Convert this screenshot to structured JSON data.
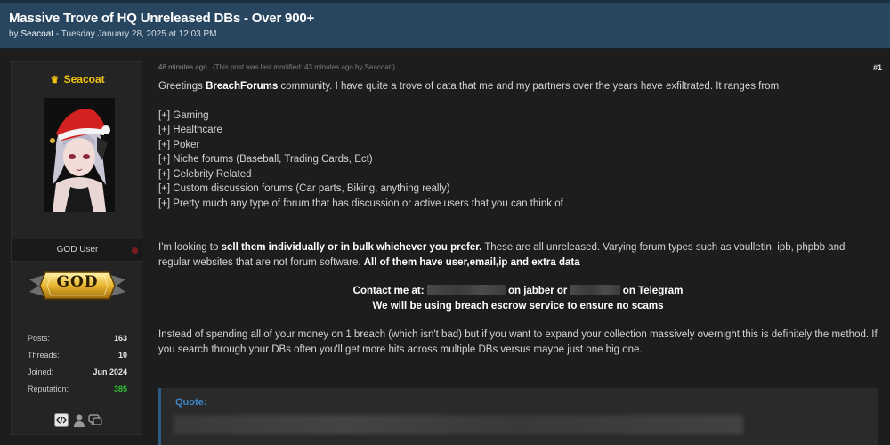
{
  "header": {
    "title": "Massive Trove of HQ Unreleased DBs - Over 900+",
    "by_prefix": "by",
    "author": "Seacoat",
    "date": "Tuesday January 28, 2025 at 12:03 PM"
  },
  "sidebar": {
    "username": "Seacoat",
    "crown": "♛",
    "user_title": "GOD User",
    "rank_badge": "GOD",
    "stats": [
      {
        "label": "Posts:",
        "value": "163"
      },
      {
        "label": "Threads:",
        "value": "10"
      },
      {
        "label": "Joined:",
        "value": "Jun 2024"
      },
      {
        "label": "Reputation:",
        "value": "385"
      }
    ],
    "icons": [
      "code-icon",
      "user-icon",
      "chat-icon"
    ],
    "colors": {
      "username": "#f2c40f",
      "reputation": "#2fbf2f"
    }
  },
  "post": {
    "time": "46 minutes ago",
    "edited_note": "(This post was last modified: 43 minutes ago by Seacoat.)",
    "number": "#1",
    "greeting_a": "Greetings ",
    "greeting_bold": "BreachForums",
    "greeting_b": " community. I have quite a trove of data that me and my partners over the years have exfiltrated. It ranges from",
    "list": [
      "[+] Gaming",
      "[+] Healthcare",
      "[+] Poker",
      "[+] Niche forums (Baseball, Trading Cards, Ect)",
      "[+] Celebrity Related",
      "[+] Custom discussion forums (Car parts, Biking, anything really)",
      "[+] Pretty much any type of forum that has discussion or active users that you can think of"
    ],
    "sell_a": "I'm looking to ",
    "sell_bold": "sell them individually or in bulk whichever you prefer.",
    "sell_b": " These are all unreleased. Varying forum types such as vbulletin, ipb, phpbb and regular websites that are not forum software. ",
    "sell_bold2": "All of them have user,email,ip and extra data",
    "contact_a": "Contact me at: ",
    "contact_b": " on jabber or ",
    "contact_c": " on Telegram",
    "escrow": "We will be using breach escrow service to ensure no scams",
    "closing": "Instead of spending all of your money on 1 breach (which isn't bad) but if you want to expand your collection massively overnight this is definitely the method. If you search through your DBs often you'll get more hits across multiple DBs versus maybe just one big one.",
    "quote_label": "Quote:"
  }
}
